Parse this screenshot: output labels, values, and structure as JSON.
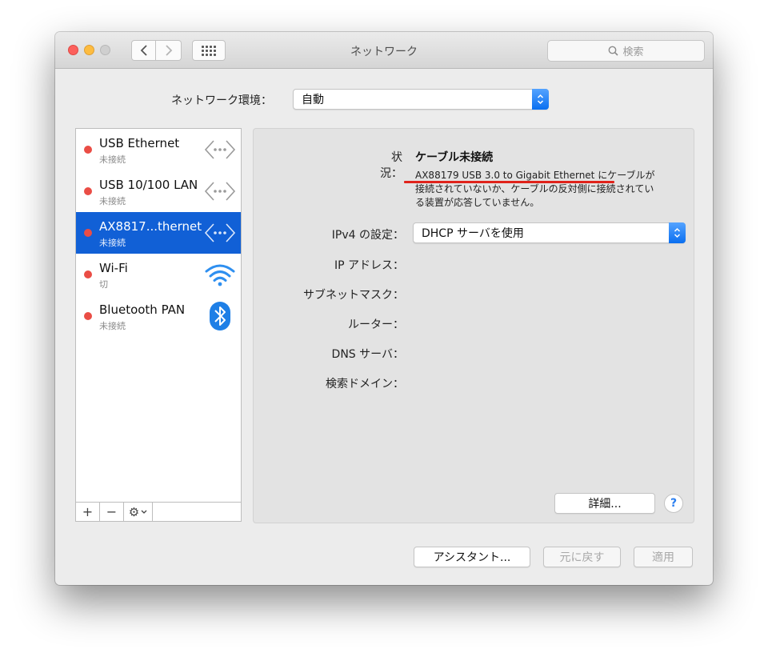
{
  "window": {
    "title": "ネットワーク",
    "search_placeholder": "検索"
  },
  "location": {
    "label": "ネットワーク環境：",
    "value": "自動"
  },
  "services": [
    {
      "name": "USB Ethernet",
      "status": "未接続",
      "icon": "ethernet-icon",
      "selected": false
    },
    {
      "name": "USB 10/100 LAN",
      "status": "未接続",
      "icon": "ethernet-icon",
      "selected": false
    },
    {
      "name": "AX8817...thernet",
      "status": "未接続",
      "icon": "ethernet-icon",
      "selected": true
    },
    {
      "name": "Wi-Fi",
      "status": "切",
      "icon": "wifi-icon",
      "selected": false
    },
    {
      "name": "Bluetooth PAN",
      "status": "未接続",
      "icon": "bluetooth-icon",
      "selected": false
    }
  ],
  "sidebar_toolbar": {
    "add": "+",
    "remove": "−",
    "gear": "⚙"
  },
  "detail": {
    "status_label": "状況：",
    "status_value": "ケーブル未接続",
    "status_description": "AX88179 USB 3.0 to Gigabit Ethernet にケーブルが接続されていないか、ケーブルの反対側に接続されている装置が応答していません。",
    "ipv4_label": "IPv4 の設定：",
    "ipv4_value": "DHCP サーバを使用",
    "ip_address_label": "IP アドレス：",
    "subnet_label": "サブネットマスク：",
    "router_label": "ルーター：",
    "dns_label": "DNS サーバ：",
    "search_domain_label": "検索ドメイン：",
    "details_button": "詳細...",
    "help_button": "?"
  },
  "footer": {
    "assistant_button": "アシスタント...",
    "revert_button": "元に戻す",
    "apply_button": "適用"
  },
  "colors": {
    "selection": "#1160d6",
    "status_dot": "#ea4d45",
    "annotation_line": "#e0231b",
    "accent": "#2a7ef0"
  }
}
